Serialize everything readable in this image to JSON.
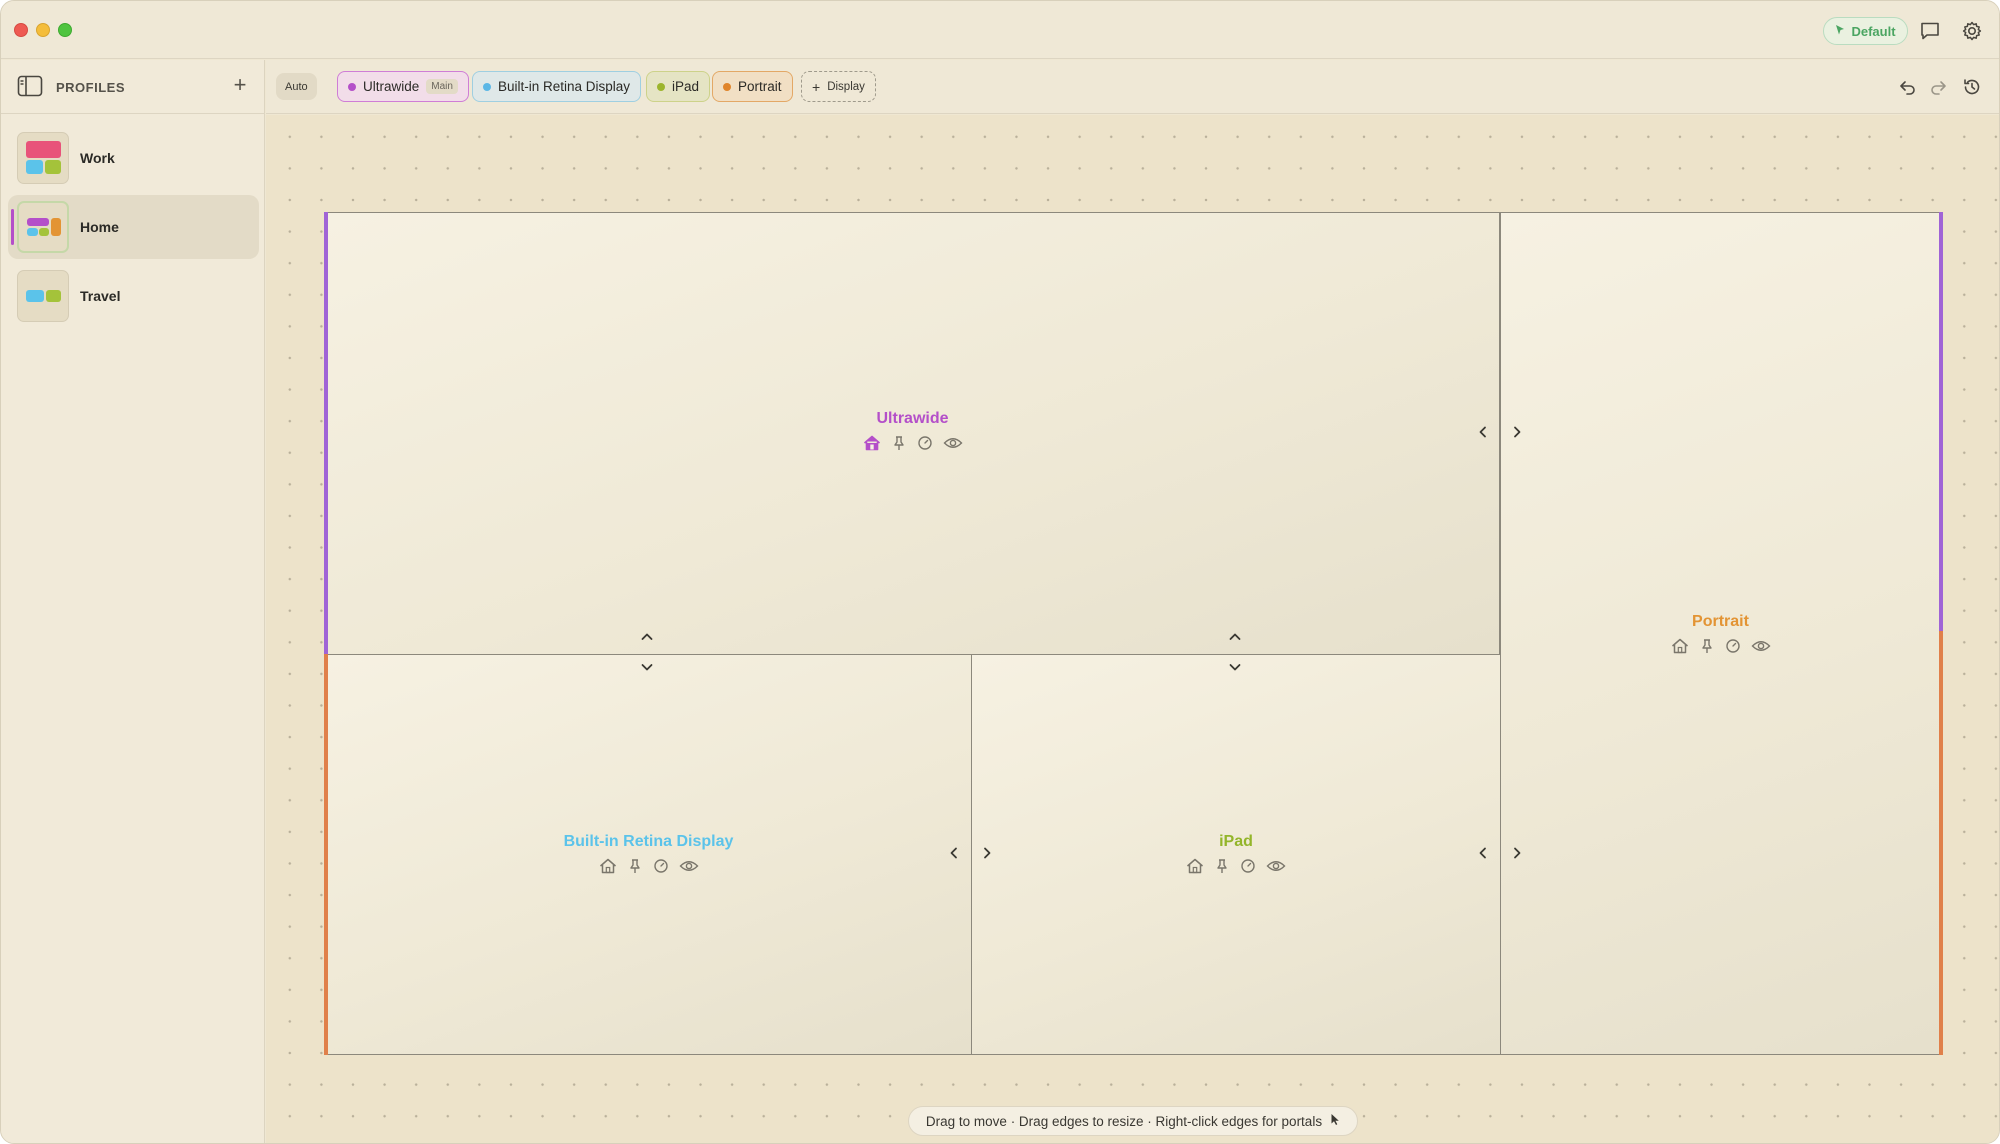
{
  "titlebar": {
    "default_label": "Default",
    "icons": [
      "cursor-icon",
      "message-icon",
      "gear-icon"
    ]
  },
  "sidebar": {
    "title": "PROFILES",
    "add_label": "+",
    "profiles": [
      {
        "name": "Work",
        "active": false
      },
      {
        "name": "Home",
        "active": true
      },
      {
        "name": "Travel",
        "active": false
      }
    ]
  },
  "toolbar": {
    "auto_label": "Auto",
    "chips": [
      {
        "label": "Ultrawide",
        "badge": "Main",
        "color": "#b44fc9"
      },
      {
        "label": "Built-in Retina Display",
        "color": "#5bb7e6"
      },
      {
        "label": "iPad",
        "color": "#9cb52d"
      },
      {
        "label": "Portrait",
        "color": "#e0842a"
      }
    ],
    "add_display_label": "Display",
    "actions": [
      "undo-icon",
      "redo-icon",
      "history-icon"
    ]
  },
  "displays": [
    {
      "name": "Ultrawide",
      "color": "#b44fc9",
      "home_active": true
    },
    {
      "name": "Built-in Retina Display",
      "color": "#5bc3ea",
      "home_active": false
    },
    {
      "name": "iPad",
      "color": "#93b52a",
      "home_active": false
    },
    {
      "name": "Portrait",
      "color": "#e39434",
      "home_active": false
    }
  ],
  "display_icons": [
    "home-icon",
    "pin-icon",
    "gauge-icon",
    "eye-icon"
  ],
  "hint": "Drag to move · Drag edges to resize · Right-click edges for portals",
  "colors": {
    "portal_purple": "#a064d6",
    "portal_orange": "#e0804a"
  }
}
